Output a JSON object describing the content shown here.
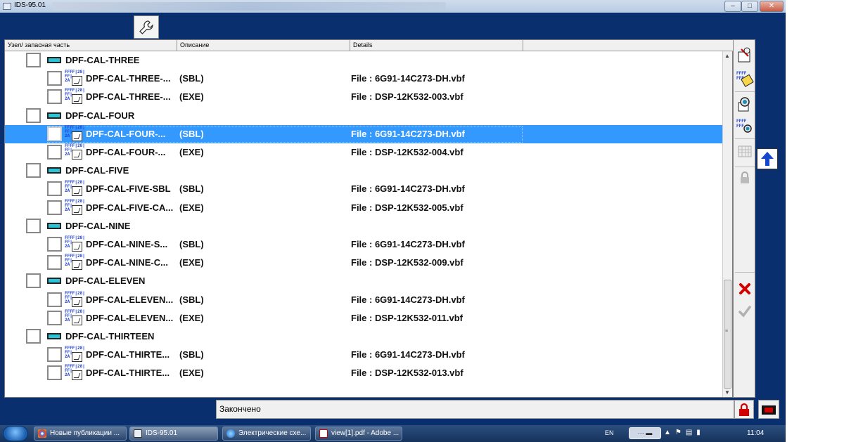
{
  "window": {
    "title": "IDS-95.01"
  },
  "columns": [
    "Узел/ запасная часть",
    "Описание",
    "Details"
  ],
  "groups": [
    {
      "name": "DPF-CAL-THREE",
      "items": [
        {
          "label": "DPF-CAL-THREE-...",
          "type": "(SBL)",
          "file": "File : 6G91-14C273-DH.vbf"
        },
        {
          "label": "DPF-CAL-THREE-...",
          "type": "(EXE)",
          "file": "File : DSP-12K532-003.vbf"
        }
      ]
    },
    {
      "name": "DPF-CAL-FOUR",
      "items": [
        {
          "label": "DPF-CAL-FOUR-...",
          "type": "(SBL)",
          "file": "File : 6G91-14C273-DH.vbf"
        },
        {
          "label": "DPF-CAL-FOUR-...",
          "type": "(EXE)",
          "file": "File : DSP-12K532-004.vbf"
        }
      ]
    },
    {
      "name": "DPF-CAL-FIVE",
      "items": [
        {
          "label": "DPF-CAL-FIVE-SBL",
          "type": "(SBL)",
          "file": "File : 6G91-14C273-DH.vbf"
        },
        {
          "label": "DPF-CAL-FIVE-CA...",
          "type": "(EXE)",
          "file": "File : DSP-12K532-005.vbf"
        }
      ]
    },
    {
      "name": "DPF-CAL-NINE",
      "items": [
        {
          "label": "DPF-CAL-NINE-S...",
          "type": "(SBL)",
          "file": "File : 6G91-14C273-DH.vbf"
        },
        {
          "label": "DPF-CAL-NINE-C...",
          "type": "(EXE)",
          "file": "File : DSP-12K532-009.vbf"
        }
      ]
    },
    {
      "name": "DPF-CAL-ELEVEN",
      "items": [
        {
          "label": "DPF-CAL-ELEVEN...",
          "type": "(SBL)",
          "file": "File : 6G91-14C273-DH.vbf"
        },
        {
          "label": "DPF-CAL-ELEVEN...",
          "type": "(EXE)",
          "file": "File : DSP-12K532-011.vbf"
        }
      ]
    },
    {
      "name": "DPF-CAL-THIRTEEN",
      "items": [
        {
          "label": "DPF-CAL-THIRTE...",
          "type": "(SBL)",
          "file": "File : 6G91-14C273-DH.vbf"
        },
        {
          "label": "DPF-CAL-THIRTE...",
          "type": "(EXE)",
          "file": "File : DSP-12K532-013.vbf"
        }
      ]
    }
  ],
  "status": {
    "text": "Закончено"
  },
  "taskbar": {
    "tasks": [
      {
        "label": "Новые публикации ..."
      },
      {
        "label": "IDS-95.01"
      },
      {
        "label": "Электрические схе..."
      },
      {
        "label": "view[1].pdf - Adobe ..."
      }
    ],
    "lang": "EN",
    "clock": "11:04"
  },
  "icons": {
    "hex_text": "FFFF|28|FF|2A",
    "selected_row_color": "#3399ff",
    "group_icon_color": "#2bc3d6"
  }
}
